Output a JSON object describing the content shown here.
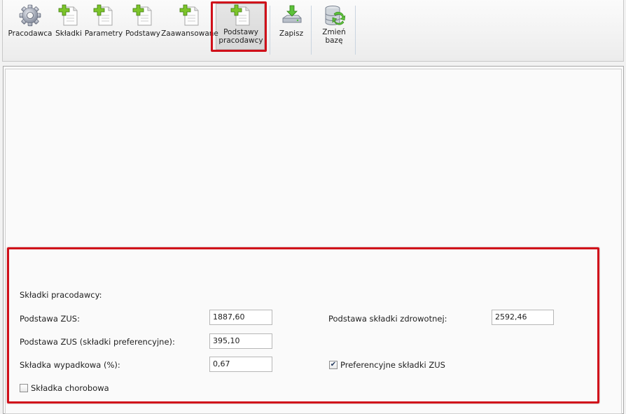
{
  "toolbar": {
    "buttons": [
      {
        "label": "Pracodawca",
        "icon": "gear-icon"
      },
      {
        "label": "Składki",
        "icon": "add-document-icon"
      },
      {
        "label": "Parametry",
        "icon": "add-document-icon"
      },
      {
        "label": "Podstawy",
        "icon": "add-document-icon"
      },
      {
        "label": "Zaawansowane",
        "icon": "add-document-icon"
      },
      {
        "label_line1": "Podstawy",
        "label_line2": "pracodawcy",
        "icon": "add-document-icon",
        "active": true
      },
      {
        "label": "Zapisz",
        "icon": "save-download-icon"
      },
      {
        "label_line1": "Zmień",
        "label_line2": "bazę",
        "icon": "database-refresh-icon"
      }
    ]
  },
  "form": {
    "section_title": "Składki pracodawcy:",
    "podstawa_zus_label": "Podstawa ZUS:",
    "podstawa_zus_value": "1887,60",
    "podstawa_zus_pref_label": "Podstawa ZUS (składki preferencyjne):",
    "podstawa_zus_pref_value": "395,10",
    "skladka_wypadkowa_label": "Składka wypadkowa (%):",
    "skladka_wypadkowa_value": "0,67",
    "skladka_chorobowa_label": "Składka chorobowa",
    "skladka_chorobowa_checked": false,
    "podstawa_zdrowotnej_label": "Podstawa składki zdrowotnej:",
    "podstawa_zdrowotnej_value": "2592,46",
    "preferencyjne_label": "Preferencyjne składki ZUS",
    "preferencyjne_checked": true
  },
  "colors": {
    "highlight_red": "#d0101a",
    "plus_green": "#7cc42a"
  }
}
